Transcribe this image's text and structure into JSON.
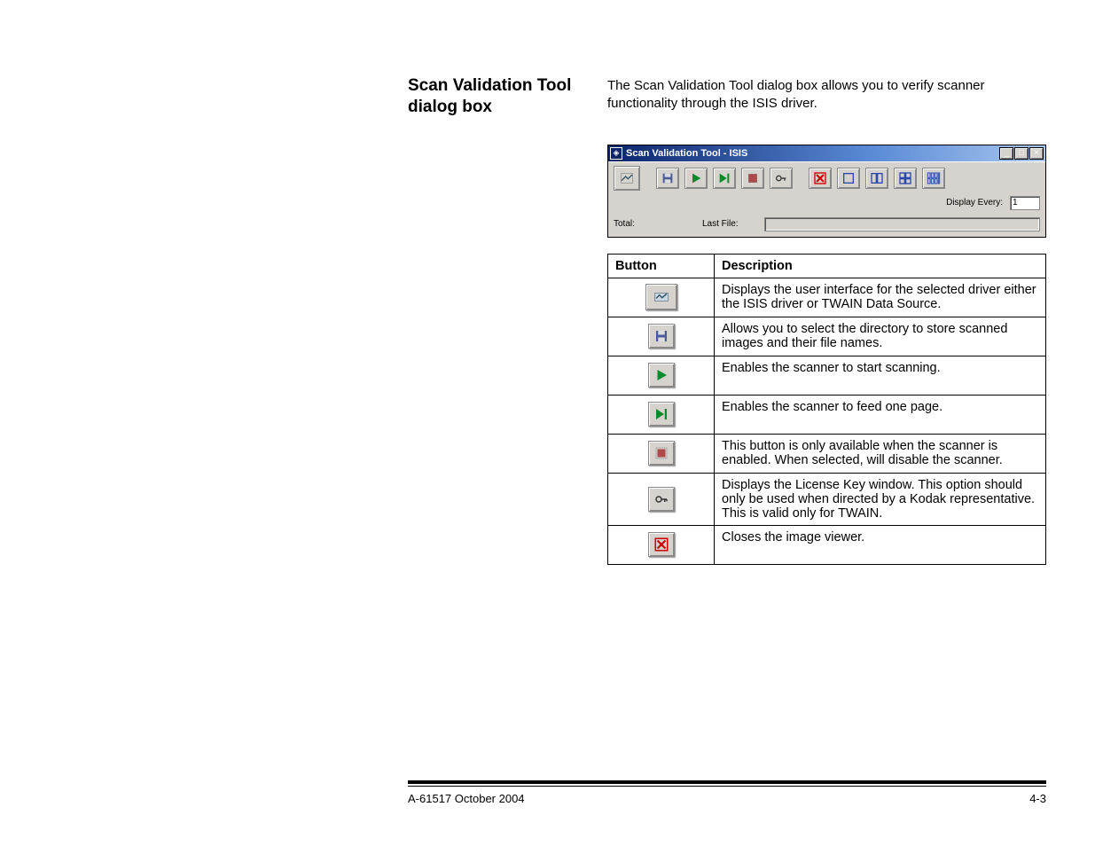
{
  "heading": "Scan Validation Tool dialog box",
  "intro": "The Scan Validation Tool dialog box allows you to verify scanner functionality through the ISIS driver.",
  "dialog": {
    "title": "Scan Validation Tool - ISIS",
    "display_every_label": "Display Every:",
    "display_every_value": "1",
    "total_label": "Total:",
    "last_file_label": "Last File:"
  },
  "table": {
    "headers": {
      "button": "Button",
      "description": "Description"
    },
    "rows": [
      {
        "icon": "driver-ui",
        "desc": "Displays the user interface for the selected driver either the ISIS driver or TWAIN Data Source."
      },
      {
        "icon": "save-dir",
        "desc": "Allows you to select the directory to store scanned images and their file names."
      },
      {
        "icon": "play",
        "desc": "Enables the scanner to start scanning."
      },
      {
        "icon": "step",
        "desc": "Enables the scanner to feed one page."
      },
      {
        "icon": "stop",
        "desc": "This button is only available when the scanner is enabled. When selected, will disable the scanner."
      },
      {
        "icon": "key",
        "desc": "Displays the License Key window. This option should only be used when directed by a Kodak representative. This is valid only for TWAIN."
      },
      {
        "icon": "close-x",
        "desc": "Closes the image viewer."
      }
    ]
  },
  "footer": {
    "left": "A-61517 October 2004",
    "right": "4-3"
  }
}
